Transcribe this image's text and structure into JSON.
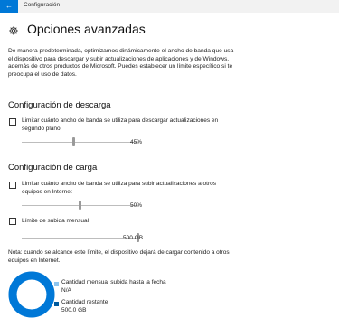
{
  "window": {
    "title": "Configuración"
  },
  "colors": {
    "accent": "#0078d7",
    "used": "#8ec5ef",
    "remaining": "#005a9e"
  },
  "page": {
    "title": "Opciones avanzadas"
  },
  "intro": "De manera predeterminada, optimizamos dinámicamente el ancho de banda que usa el dispositivo para descargar y subir actualizaciones de aplicaciones y de Windows, además de otros productos de Microsoft. Puedes establecer un límite específico si te preocupa el uso de datos.",
  "download": {
    "heading": "Configuración de descarga",
    "checkbox_label": "Limitar cuánto ancho de banda se utiliza para descargar actualizaciones en segundo plano",
    "checked": false,
    "slider_value_percent": 45,
    "slider_label": "45%"
  },
  "upload": {
    "heading": "Configuración de carga",
    "checkbox_label": "Limitar cuánto ancho de banda se utiliza para subir actualizaciones a otros equipos en Internet",
    "checked": false,
    "slider_value_percent": 50,
    "slider_label": "50%",
    "monthly_label": "Límite de subida mensual",
    "monthly_checked": false,
    "monthly_value_fraction": 1.0,
    "monthly_value_label": "500 GB"
  },
  "note": "Nota: cuando se alcance este límite, el dispositivo dejará de cargar contenido a otros equipos en Internet.",
  "usage": {
    "uploaded_label": "Cantidad mensual subida hasta la fecha",
    "uploaded_value": "N/A",
    "remaining_label": "Cantidad restante",
    "remaining_value": "500.0 GB",
    "remaining_fraction": 1.0
  }
}
